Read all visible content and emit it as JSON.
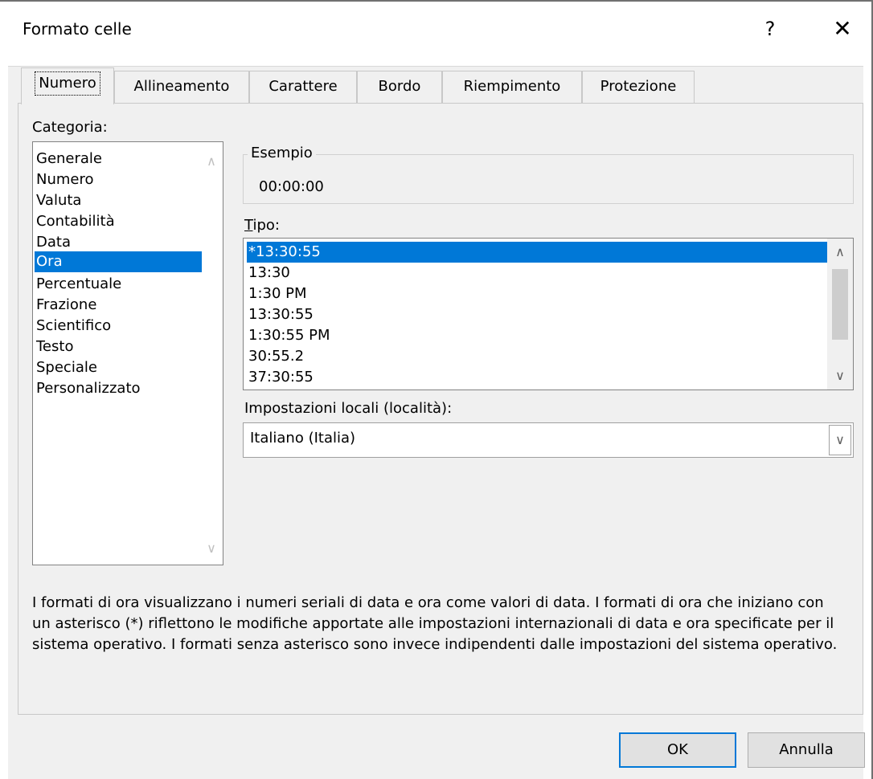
{
  "window": {
    "title": "Formato celle"
  },
  "titlebar": {
    "help_label": "?",
    "close_label": "✕"
  },
  "tabs": [
    {
      "label": "Numero"
    },
    {
      "label": "Allineamento"
    },
    {
      "label": "Carattere"
    },
    {
      "label": "Bordo"
    },
    {
      "label": "Riempimento"
    },
    {
      "label": "Protezione"
    }
  ],
  "category": {
    "label": "Categoria:",
    "items": [
      {
        "label": "Generale"
      },
      {
        "label": "Numero"
      },
      {
        "label": "Valuta"
      },
      {
        "label": "Contabilità"
      },
      {
        "label": "Data"
      },
      {
        "label": "Ora"
      },
      {
        "label": "Percentuale"
      },
      {
        "label": "Frazione"
      },
      {
        "label": "Scientifico"
      },
      {
        "label": "Testo"
      },
      {
        "label": "Speciale"
      },
      {
        "label": "Personalizzato"
      }
    ],
    "selected": "Ora"
  },
  "sample": {
    "legend": "Esempio",
    "value": "00:00:00"
  },
  "type": {
    "label": "Tipo:",
    "items": [
      {
        "label": "*13:30:55"
      },
      {
        "label": "13:30"
      },
      {
        "label": "1:30 PM"
      },
      {
        "label": "13:30:55"
      },
      {
        "label": "1:30:55 PM"
      },
      {
        "label": "30:55.2"
      },
      {
        "label": "37:30:55"
      }
    ],
    "selected": "*13:30:55"
  },
  "locale": {
    "label": "Impostazioni locali (località):",
    "value": "Italiano (Italia)"
  },
  "description": "I formati di ora visualizzano i numeri seriali di data e ora come valori di data. I formati di ora che iniziano con un asterisco (*) riflettono le modifiche apportate alle impostazioni internazionali di data e ora specificate per il sistema operativo. I formati senza asterisco sono invece indipendenti dalle impostazioni del sistema operativo.",
  "buttons": {
    "ok": "OK",
    "cancel": "Annulla"
  },
  "colors": {
    "selection": "#0078d7",
    "panel": "#f0f0f0"
  }
}
